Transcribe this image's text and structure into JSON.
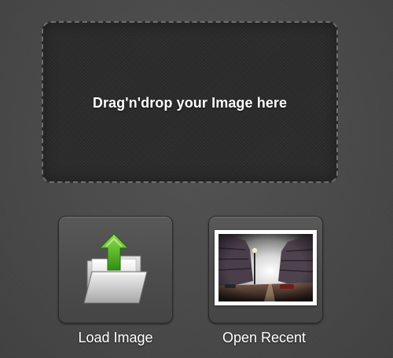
{
  "drop_zone": {
    "text": "Drag'n'drop your Image here"
  },
  "actions": [
    {
      "label": "Load Image",
      "icon": "folder-upload-icon"
    },
    {
      "label": "Open Recent",
      "icon": "recent-image-thumbnail"
    }
  ],
  "colors": {
    "background": "#4a4a4a",
    "drop_zone": "#2d2d2d",
    "text": "#ffffff",
    "arrow_green": "#4caf1f"
  }
}
